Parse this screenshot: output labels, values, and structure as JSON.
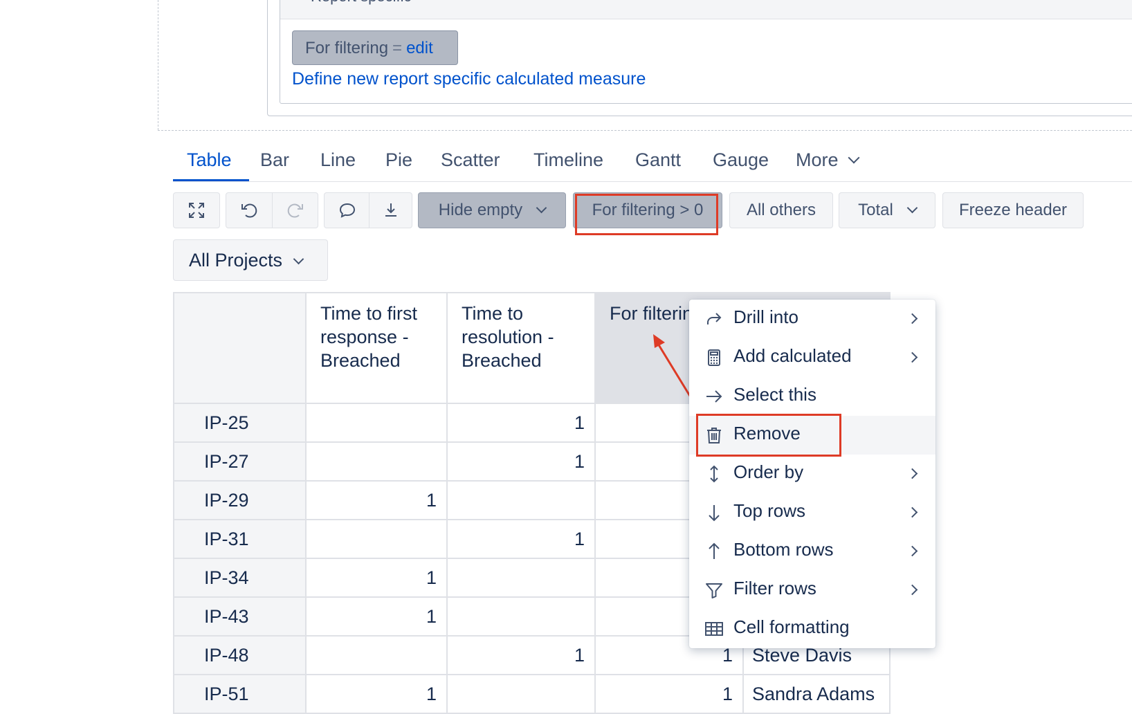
{
  "report_specific": {
    "section_header": "Report specific",
    "measure_chip": {
      "name": "For filtering",
      "eq": "=",
      "edit": "edit"
    },
    "define_link": "Define new report specific calculated measure"
  },
  "tabs": [
    {
      "label": "Table",
      "active": true
    },
    {
      "label": "Bar"
    },
    {
      "label": "Line"
    },
    {
      "label": "Pie"
    },
    {
      "label": "Scatter"
    },
    {
      "label": "Timeline"
    },
    {
      "label": "Gantt"
    },
    {
      "label": "Gauge"
    },
    {
      "label": "More"
    }
  ],
  "toolbar": {
    "hide_empty": "Hide empty",
    "filter_chip": "For filtering > 0",
    "all_others": "All others",
    "total": "Total",
    "freeze_header": "Freeze header",
    "icons": [
      "expand-icon",
      "undo-icon",
      "redo-icon",
      "comment-icon",
      "download-icon"
    ]
  },
  "projects_select": "All Projects",
  "table": {
    "columns": [
      "Time to first response - Breached",
      "Time to resolution - Breached",
      "For filtering",
      ""
    ],
    "rows": [
      {
        "id": "IP-25",
        "c1": "",
        "c2": "1",
        "c3": "",
        "c4": ""
      },
      {
        "id": "IP-27",
        "c1": "",
        "c2": "1",
        "c3": "",
        "c4": ""
      },
      {
        "id": "IP-29",
        "c1": "1",
        "c2": "",
        "c3": "",
        "c4": ""
      },
      {
        "id": "IP-31",
        "c1": "",
        "c2": "1",
        "c3": "",
        "c4": ""
      },
      {
        "id": "IP-34",
        "c1": "1",
        "c2": "",
        "c3": "",
        "c4": ""
      },
      {
        "id": "IP-43",
        "c1": "1",
        "c2": "",
        "c3": "",
        "c4": ""
      },
      {
        "id": "IP-48",
        "c1": "",
        "c2": "1",
        "c3": "1",
        "c4": "Steve Davis"
      },
      {
        "id": "IP-51",
        "c1": "1",
        "c2": "",
        "c3": "1",
        "c4": "Sandra Adams"
      }
    ]
  },
  "context_menu": {
    "items": [
      {
        "label": "Drill into",
        "icon": "drill-into-icon",
        "submenu": true
      },
      {
        "label": "Add calculated",
        "icon": "calculator-icon",
        "submenu": true
      },
      {
        "label": "Select this",
        "icon": "arrow-right-icon",
        "submenu": false
      },
      {
        "label": "Remove",
        "icon": "trash-icon",
        "submenu": false,
        "hover": true
      },
      {
        "label": "Order by",
        "icon": "sort-icon",
        "submenu": true
      },
      {
        "label": "Top rows",
        "icon": "arrow-down-icon",
        "submenu": true
      },
      {
        "label": "Bottom rows",
        "icon": "arrow-up-icon",
        "submenu": true
      },
      {
        "label": "Filter rows",
        "icon": "filter-icon",
        "submenu": true
      },
      {
        "label": "Cell formatting",
        "icon": "grid-icon",
        "submenu": false
      }
    ]
  },
  "colors": {
    "accent": "#0052cc",
    "annotation_red": "#de3b26",
    "selected_chip": "#b3b9c4",
    "text": "#172b4d"
  }
}
